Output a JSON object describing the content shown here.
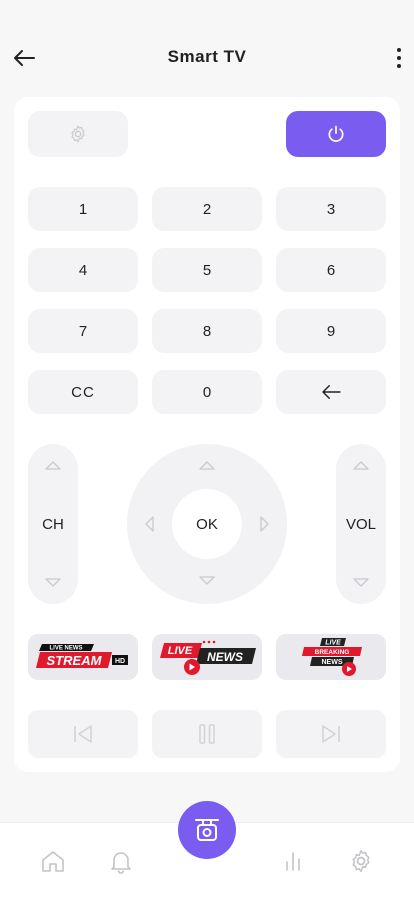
{
  "header": {
    "title": "Smart TV",
    "back_icon": "arrow-left-icon",
    "more_icon": "vertical-dots-icon"
  },
  "remote": {
    "settings_icon": "gear-icon",
    "power_icon": "power-icon",
    "keypad": [
      "1",
      "2",
      "3",
      "4",
      "5",
      "6",
      "7",
      "8",
      "9",
      "CC",
      "0"
    ],
    "backspace_icon": "arrow-left-icon",
    "channel_label": "CH",
    "ok_label": "OK",
    "volume_label": "VOL"
  },
  "channels": [
    {
      "top": "LIVE NEWS",
      "main": "STREAM",
      "tag": "HD"
    },
    {
      "top": "LIVE",
      "main": "NEWS"
    },
    {
      "top": "LIVE",
      "mid": "BREAKING",
      "main": "NEWS"
    }
  ],
  "media": [
    "skip-back-icon",
    "pause-icon",
    "skip-forward-icon"
  ],
  "nav": {
    "items": [
      "home-icon",
      "bell-icon",
      "remote-icon",
      "chart-bars-icon",
      "gear-icon"
    ]
  },
  "colors": {
    "accent": "#7b5cf0",
    "button_bg": "#f3f3f5",
    "red": "#e0192d"
  }
}
